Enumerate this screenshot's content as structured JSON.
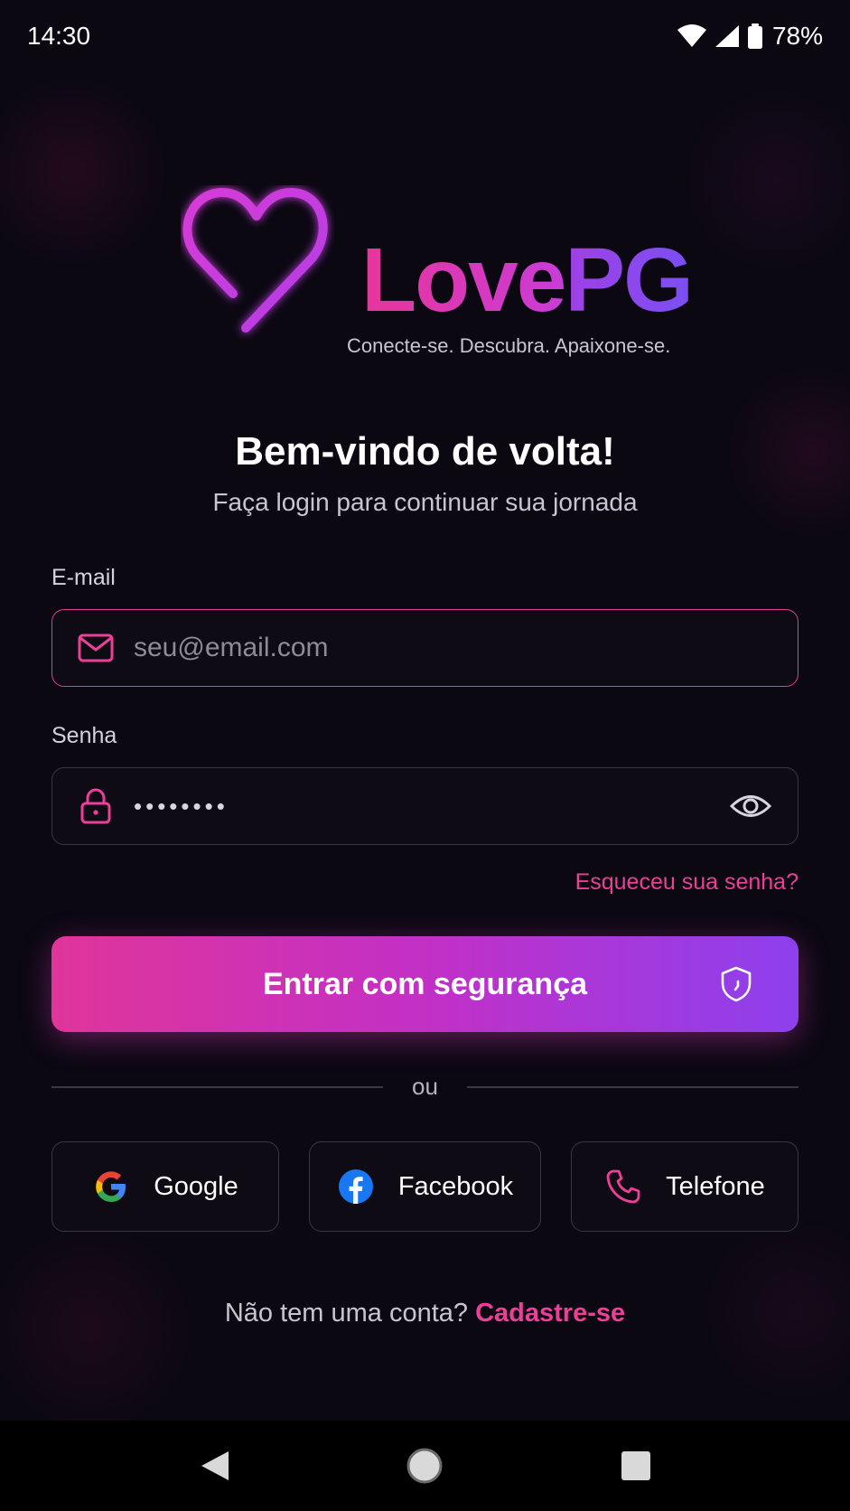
{
  "status_bar": {
    "time": "14:30",
    "battery": "78%",
    "icons": [
      "wifi-icon",
      "signal-icon",
      "battery-icon"
    ]
  },
  "brand": {
    "name_part1": "Love",
    "name_part2": "PG",
    "tagline": "Conecte-se. Descubra. Apaixone-se.",
    "colors": {
      "pink": "#e8359a",
      "purple": "#7a4ff2"
    }
  },
  "header": {
    "title": "Bem-vindo de volta!",
    "subtitle": "Faça login para continuar sua jornada"
  },
  "form": {
    "email": {
      "label": "E-mail",
      "placeholder": "seu@email.com",
      "value": "",
      "icon": "mail-icon"
    },
    "password": {
      "label": "Senha",
      "value_masked": "••••••••",
      "icon": "lock-icon",
      "toggle_icon": "eye-icon"
    },
    "forgot_link": "Esqueceu sua senha?",
    "submit_label": "Entrar com segurança",
    "submit_icon": "shield-icon"
  },
  "divider_text": "ou",
  "social": [
    {
      "label": "Google",
      "icon": "google-icon"
    },
    {
      "label": "Facebook",
      "icon": "facebook-icon"
    },
    {
      "label": "Telefone",
      "icon": "phone-icon"
    }
  ],
  "footer": {
    "prompt": "Não tem uma conta?",
    "signup_link": "Cadastre-se"
  },
  "nav_bar": {
    "icons": [
      "back-icon",
      "home-icon",
      "recents-icon"
    ]
  }
}
